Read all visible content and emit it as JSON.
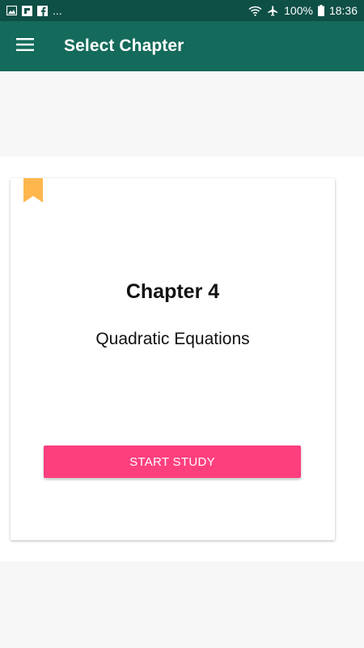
{
  "status_bar": {
    "left_icons": [
      "gallery-icon",
      "flipboard-icon",
      "facebook-icon"
    ],
    "more_indicator": "...",
    "battery_percent": "100%",
    "time": "18:36"
  },
  "app_bar": {
    "title": "Select Chapter",
    "menu_icon": "hamburger-menu-icon"
  },
  "card": {
    "chapter_number": "Chapter 4",
    "chapter_title": "Quadratic Equations",
    "button_label": "START STUDY",
    "bookmark_icon": "bookmark-icon"
  },
  "colors": {
    "status_bar": "#0e4f46",
    "app_bar": "#146a5b",
    "accent_button": "#fd3f7e",
    "bookmark": "#ffb74d"
  }
}
